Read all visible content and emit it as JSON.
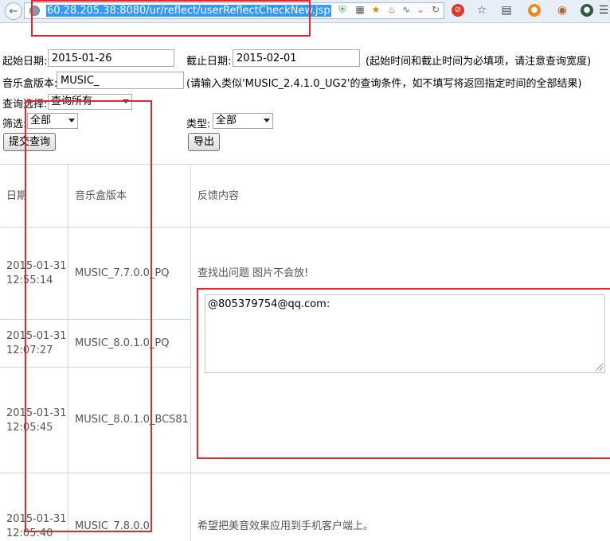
{
  "browser": {
    "url": "60.28.205.38:8080/ur/reflect/userReflectCheckNew.jsp"
  },
  "form": {
    "start_date_label": "起始日期:",
    "start_date_value": "2015-01-26",
    "end_date_label": "截止日期:",
    "end_date_value": "2015-02-01",
    "date_hint": "(起始时间和截止时间为必填项，请注意查询宽度)",
    "version_label": "音乐盒版本:",
    "version_value": "MUSIC_",
    "version_hint": "(请输入类似'MUSIC_2.4.1.0_UG2'的查询条件，如不填写将返回指定时间的全部结果)",
    "query_label": "查询选择:",
    "query_value": "查询所有",
    "filter_label": "筛选:",
    "filter_value": "全部",
    "type_label": "类型:",
    "type_value": "全部",
    "submit_label": "提交查询",
    "export_label": "导出"
  },
  "table": {
    "headers": [
      "日期",
      "音乐盒版本",
      "反馈内容"
    ],
    "rows": [
      {
        "date": "2015-01-31",
        "time": "12:55:14",
        "version": "MUSIC_7.7.0.0_PQ",
        "content": "查找出问题 图片不会放!"
      },
      {
        "date": "2015-01-31",
        "time": "12:07:27",
        "version": "MUSIC_8.0.1.0_PQ",
        "content": ""
      },
      {
        "date": "2015-01-31",
        "time": "12:05:45",
        "version": "MUSIC_8.0.1.0_BCS81",
        "content": ""
      },
      {
        "date": "2015-01-31",
        "time": "12:05:40",
        "version": "MUSIC_7.8.0.0",
        "content": "希望把美音效果应用到手机客户端上。"
      }
    ],
    "textarea_value": "@805379754@qq.com:"
  },
  "colors": {
    "annotation": "#e0282e",
    "grid": "#c7d7e6",
    "url_highlight": "#3399ff"
  }
}
